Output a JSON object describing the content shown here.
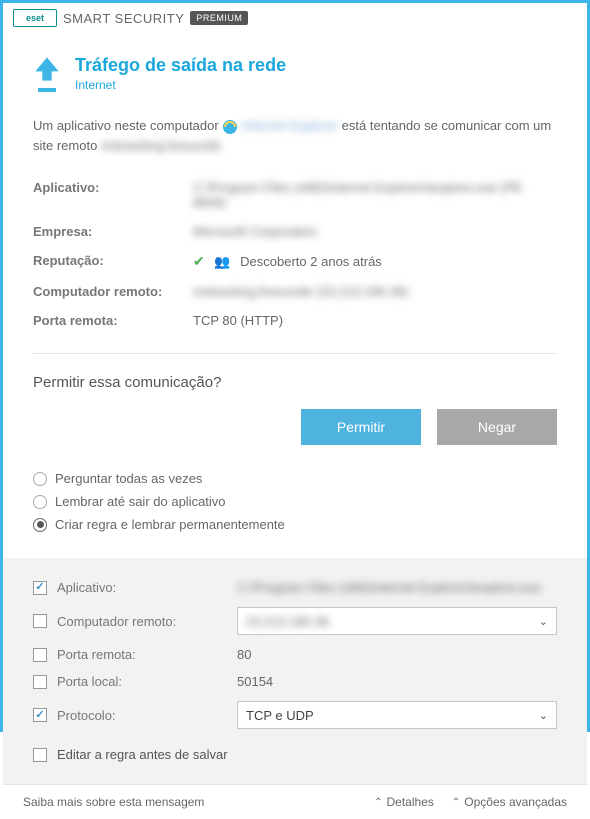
{
  "brand": {
    "logo": "eset",
    "product": "SMART SECURITY",
    "edition": "PREMIUM"
  },
  "header": {
    "title": "Tráfego de saída na rede",
    "subtitle": "Internet"
  },
  "description": {
    "prefix": "Um aplicativo neste computador ",
    "app_name_blurred": "Internet Explorer",
    "middle": " está tentando se comunicar com um site remoto ",
    "site_blurred": "mstracking.liveuxsite"
  },
  "info": {
    "app_label": "Aplicativo:",
    "app_value_blurred": "C:\\Program Files (x86)\\Internet Explorer\\iexplore.exe (PE 8846)",
    "company_label": "Empresa:",
    "company_value_blurred": "Microsoft Corporation",
    "reputation_label": "Reputação:",
    "reputation_text": "Descoberto 2 anos atrás",
    "remote_label": "Computador remoto:",
    "remote_value_blurred": "mstracking.liveuxsite (23.213.180.36)",
    "port_label": "Porta remota:",
    "port_value": "TCP 80 (HTTP)"
  },
  "prompt": "Permitir essa comunicação?",
  "buttons": {
    "allow": "Permitir",
    "deny": "Negar"
  },
  "radios": {
    "ask": "Perguntar todas as vezes",
    "remember_app": "Lembrar até sair do aplicativo",
    "create_rule": "Criar regra e lembrar permanentemente",
    "selected": "create_rule"
  },
  "rule": {
    "app_label": "Aplicativo:",
    "app_checked": true,
    "app_value_blurred": "C:\\Program Files (x86)\\Internet Explorer\\iexplore.exe",
    "remote_label": "Computador remoto:",
    "remote_checked": false,
    "remote_value_blurred": "23.213.180.36",
    "remote_port_label": "Porta remota:",
    "remote_port_checked": false,
    "remote_port_value": "80",
    "local_port_label": "Porta local:",
    "local_port_checked": false,
    "local_port_value": "50154",
    "protocol_label": "Protocolo:",
    "protocol_checked": true,
    "protocol_value": "TCP e UDP",
    "edit_label": "Editar a regra antes de salvar",
    "edit_checked": false
  },
  "footer": {
    "learn_more": "Saiba mais sobre esta mensagem",
    "details": "Detalhes",
    "advanced": "Opções avançadas"
  }
}
